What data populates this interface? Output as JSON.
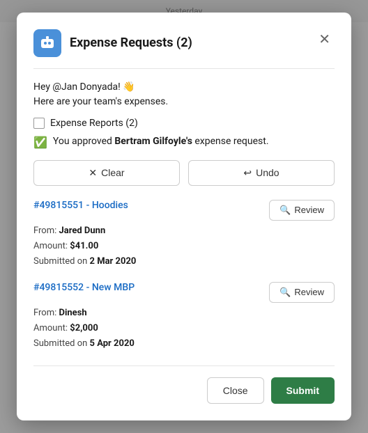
{
  "topBar": {
    "label": "Yesterday"
  },
  "modal": {
    "title": "Expense Requests (2)",
    "icon_alt": "bot-icon",
    "greeting_line1": "Hey @Jan Donyada! 👋",
    "greeting_line2": "Here are your team's expenses.",
    "expense_reports_label": "Expense Reports (2)",
    "approved_text_prefix": "You approved ",
    "approved_name": "Bertram Gilfoyle's",
    "approved_text_suffix": " expense request.",
    "clear_label": "Clear",
    "undo_label": "Undo",
    "items": [
      {
        "id": "#49815551",
        "name": "Hoodies",
        "from": "Jared Dunn",
        "amount": "$41.00",
        "submitted": "2 Mar 2020"
      },
      {
        "id": "#49815552",
        "name": "New MBP",
        "from": "Dinesh",
        "amount": "$2,000",
        "submitted": "5 Apr 2020"
      }
    ],
    "review_label": "Review",
    "close_label": "Close",
    "submit_label": "Submit",
    "colors": {
      "link": "#1a6bc4",
      "submit_bg": "#2e7d46",
      "checkmark_green": "#2e7d46"
    }
  }
}
